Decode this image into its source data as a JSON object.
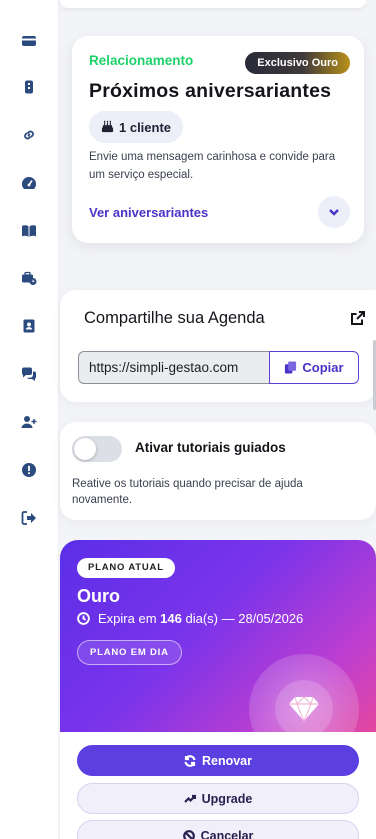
{
  "sidebar": {
    "icons": [
      "card-icon",
      "badge-icon",
      "link-icon",
      "dashboard-gauge-icon",
      "book-icon",
      "briefcase-clock-icon",
      "contact-card-icon",
      "chat-icon",
      "add-user-icon",
      "alert-icon",
      "logout-icon"
    ]
  },
  "birthdays": {
    "category": "Relacionamento",
    "badge": "Exclusivo Ouro",
    "title": "Próximos aniversariantes",
    "count_label": "1 cliente",
    "description": "Envie uma mensagem carinhosa e convide para um serviço especial.",
    "link_label": "Ver aniversariantes"
  },
  "share": {
    "title": "Compartilhe sua Agenda",
    "url": "https://simpli-gestao.com",
    "copy_label": "Copiar"
  },
  "tutorial": {
    "toggle_label": "Ativar tutoriais guiados",
    "enabled": false,
    "description": "Reative os tutoriais quando precisar de ajuda novamente."
  },
  "plan": {
    "badge": "PLANO ATUAL",
    "name": "Ouro",
    "expires_prefix": "Expira em",
    "days": "146",
    "expires_suffix": "dia(s) — 28/05/2026",
    "status": "PLANO EM DIA",
    "renew_label": "Renovar",
    "upgrade_label": "Upgrade",
    "cancel_label": "Cancelar"
  },
  "colors": {
    "accent": "#5b3fe0",
    "success": "#1dd16a",
    "sidebar_icon": "#2b4a7e"
  }
}
